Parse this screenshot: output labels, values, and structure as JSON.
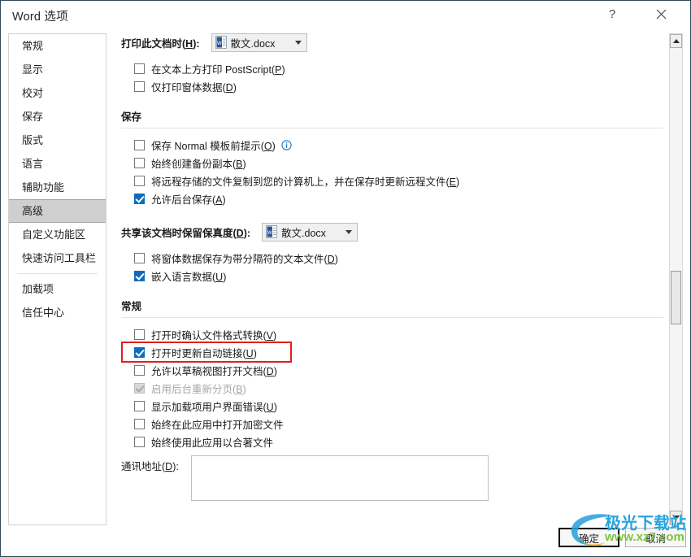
{
  "window": {
    "title": "Word 选项",
    "help_button": "?",
    "close_button": "✕"
  },
  "sidebar": {
    "items": [
      {
        "label": "常规",
        "active": false
      },
      {
        "label": "显示",
        "active": false
      },
      {
        "label": "校对",
        "active": false
      },
      {
        "label": "保存",
        "active": false
      },
      {
        "label": "版式",
        "active": false
      },
      {
        "label": "语言",
        "active": false
      },
      {
        "label": "辅助功能",
        "active": false
      },
      {
        "label": "高级",
        "active": true
      },
      {
        "label": "自定义功能区",
        "active": false
      },
      {
        "label": "快速访问工具栏",
        "active": false
      },
      {
        "label": "加载项",
        "active": false
      },
      {
        "label": "信任中心",
        "active": false
      }
    ]
  },
  "print_section": {
    "label_prefix": "打印此文档时(",
    "label_key": "H",
    "label_suffix": "):",
    "combo_value": "散文.docx",
    "options": [
      {
        "label_prefix": "在文本上方打印 PostScript(",
        "key": "P",
        "label_suffix": ")",
        "checked": false
      },
      {
        "label_prefix": "仅打印窗体数据(",
        "key": "D",
        "label_suffix": ")",
        "checked": false
      }
    ]
  },
  "save_section": {
    "title": "保存",
    "options": [
      {
        "label_prefix": "保存 Normal 模板前提示(",
        "key": "O",
        "label_suffix": ")",
        "checked": false,
        "info": true
      },
      {
        "label_prefix": "始终创建备份副本(",
        "key": "B",
        "label_suffix": ")",
        "checked": false,
        "info": false
      },
      {
        "label_prefix": "将远程存储的文件复制到您的计算机上，并在保存时更新远程文件(",
        "key": "E",
        "label_suffix": ")",
        "checked": false,
        "info": false
      },
      {
        "label_prefix": "允许后台保存(",
        "key": "A",
        "label_suffix": ")",
        "checked": true,
        "info": false
      }
    ]
  },
  "fidelity_section": {
    "label_prefix": "共享该文档时保留保真度(",
    "label_key": "D",
    "label_suffix": "):",
    "combo_value": "散文.docx",
    "options": [
      {
        "label_prefix": "将窗体数据保存为带分隔符的文本文件(",
        "key": "D",
        "label_suffix": ")",
        "checked": false
      },
      {
        "label_prefix": "嵌入语言数据(",
        "key": "U",
        "label_suffix": ")",
        "checked": true
      }
    ]
  },
  "general_section": {
    "title": "常规",
    "options": [
      {
        "label_prefix": "打开时确认文件格式转换(",
        "key": "V",
        "label_suffix": ")",
        "checked": false,
        "disabled": false,
        "highlighted": false
      },
      {
        "label_prefix": "打开时更新自动链接(",
        "key": "U",
        "label_suffix": ")",
        "checked": true,
        "disabled": false,
        "highlighted": true
      },
      {
        "label_prefix": "允许以草稿视图打开文档(",
        "key": "D",
        "label_suffix": ")",
        "checked": false,
        "disabled": false,
        "highlighted": false
      },
      {
        "label_prefix": "启用后台重新分页(",
        "key": "B",
        "label_suffix": ")",
        "checked": true,
        "disabled": true,
        "highlighted": false
      },
      {
        "label_prefix": "显示加载项用户界面错误(",
        "key": "U",
        "label_suffix": ")",
        "checked": false,
        "disabled": false,
        "highlighted": false
      },
      {
        "label_prefix": "始终在此应用中打开加密文件",
        "key": "",
        "label_suffix": "",
        "checked": false,
        "disabled": false,
        "highlighted": false
      },
      {
        "label_prefix": "始终使用此应用以合著文件",
        "key": "",
        "label_suffix": "",
        "checked": false,
        "disabled": false,
        "highlighted": false
      }
    ],
    "address_label_prefix": "通讯地址(",
    "address_label_key": "D",
    "address_label_suffix": "):",
    "address_value": ""
  },
  "footer": {
    "ok_label": "确定",
    "cancel_label": "取消"
  },
  "watermark": {
    "text": "极光下载站",
    "url": "www.xz7.com"
  },
  "colors": {
    "accent_checkbox": "#0f6cbd",
    "highlight_box": "#e02020",
    "sidebar_active": "#cfcfcf",
    "watermark_blue": "#29a3dc",
    "watermark_green": "#7dc242"
  }
}
